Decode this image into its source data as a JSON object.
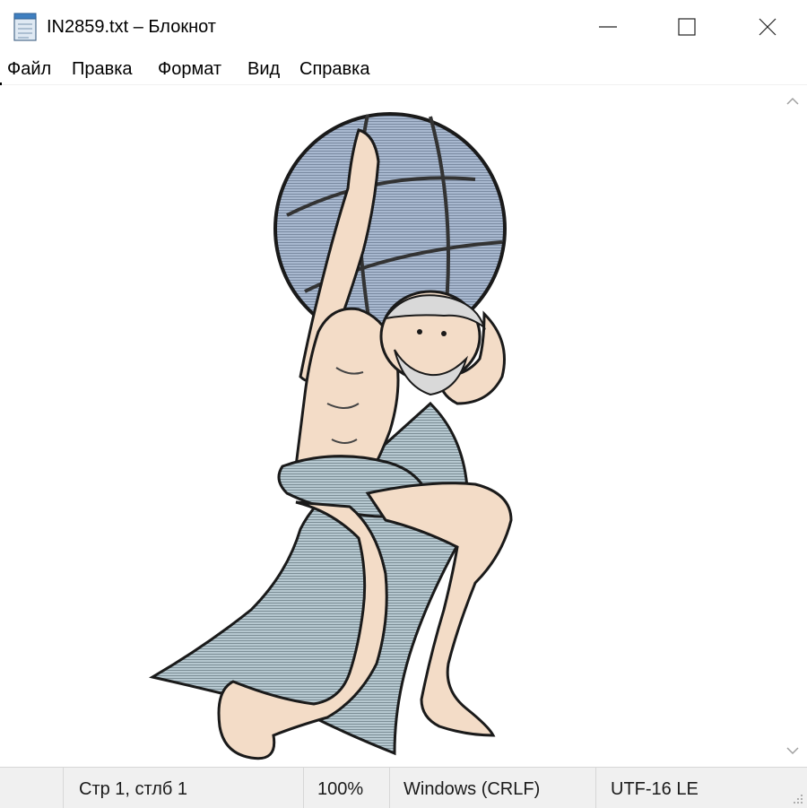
{
  "window": {
    "title": "IN2859.txt – Блокнот",
    "minimize_label": "—",
    "maximize_label": "☐",
    "close_label": "✕"
  },
  "menu": {
    "items": [
      "Файл",
      "Правка",
      "Формат",
      "Вид",
      "Справка"
    ]
  },
  "editor": {
    "content_image": "atlas-holding-globe-ascii-art"
  },
  "status": {
    "position": "Стр 1, стлб 1",
    "zoom": "100%",
    "line_endings": "Windows (CRLF)",
    "encoding": "UTF-16 LE"
  },
  "colors": {
    "globe": "#a8b8cf",
    "skin": "#f3dcc7",
    "cloth": "#b6c8d0",
    "outline": "#1a1a1a",
    "statusbar": "#f0f0f0"
  },
  "icons": [
    "notepad-icon",
    "minimize-icon",
    "maximize-icon",
    "close-icon",
    "scroll-up-icon",
    "scroll-down-icon",
    "resize-grip-icon"
  ]
}
